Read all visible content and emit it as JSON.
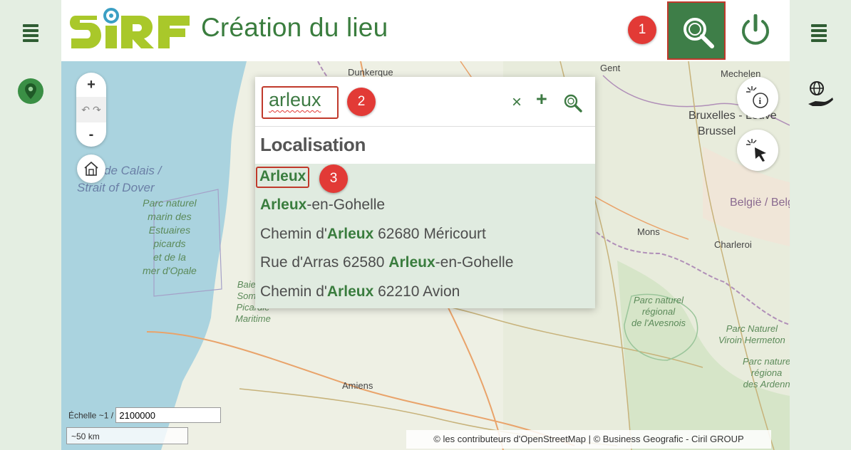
{
  "header": {
    "title": "Création du lieu",
    "search_step_badge": "1"
  },
  "map": {
    "labels": {
      "dunkerque": "Dunkerque",
      "gent": "Gent",
      "mechelen": "Mechelen",
      "bruxelles": "Bruxelles - Leuve",
      "brussel": "Brussel",
      "belgie": "België / Belgique / Belgien",
      "mons": "Mons",
      "charleroi": "Charleroi",
      "amiens": "Amiens",
      "sea_1": "de Calais /",
      "sea_2": "Strait of Dover",
      "park_opale": "Parc naturel\nmarin des\nEstuaires\npicards\net de la\nmer d'Opale",
      "park_somme": "Baie de\nSomme\nPicardie\nMaritime",
      "park_avesnois": "Parc naturel\nrégional\nde l'Avesnois",
      "park_hermeton": "Parc Naturel\nViroin Hermeton",
      "park_ardenne": "Parc nature\nrégiona\ndes Ardenn"
    },
    "zoom_in": "+",
    "zoom_out": "-",
    "scale_label": "Échelle ~1 /",
    "scale_value": "2100000",
    "scalebar_text": "~50 km",
    "attribution": "© les contributeurs d'OpenStreetMap | © Business Geografic - Ciril GROUP"
  },
  "search": {
    "query": "arleux",
    "query_badge": "2",
    "clear_label": "×",
    "add_label": "+",
    "section_title": "Localisation",
    "result_badge": "3",
    "results": [
      {
        "before": "",
        "match": "Arleux",
        "after": ""
      },
      {
        "before": "",
        "match": "Arleux",
        "after": "-en-Gohelle"
      },
      {
        "before": "Chemin d'",
        "match": "Arleux",
        "after": " 62680 Méricourt"
      },
      {
        "before": "Rue d'Arras 62580 ",
        "match": "Arleux",
        "after": "-en-Gohelle"
      },
      {
        "before": "Chemin d'",
        "match": "Arleux",
        "after": " 62210 Avion"
      }
    ]
  },
  "colors": {
    "brand_green": "#3e7e48",
    "logo_lime": "#a9c82a",
    "highlight_red": "#c0392b"
  }
}
